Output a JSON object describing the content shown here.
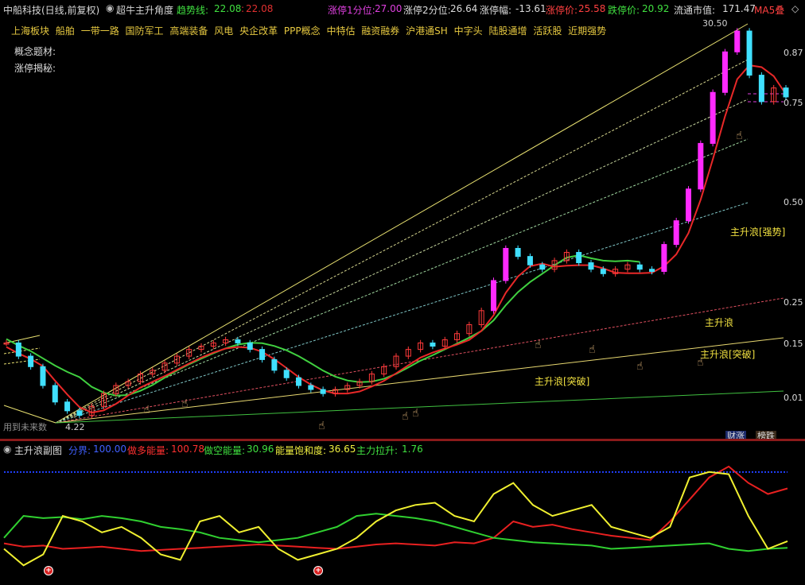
{
  "header": {
    "stock": "中船科技(日线,前复权)",
    "indicator": "超牛主升角度",
    "trend_label": "趋势线:",
    "trend_val1": "22.08",
    "trend_val2": "22.08",
    "lim1_label": "涨停1分位:",
    "lim1_val": "27.00",
    "lim2_label": "涨停2分位:",
    "lim2_val": "26.64",
    "amp_label": "涨停幅:",
    "amp_val": "-13.61",
    "up_label": "涨停价:",
    "up_val": "25.58",
    "down_label": "跌停价:",
    "down_val": "20.92",
    "mcap_label": "流通市值:",
    "mcap_val": "171.47",
    "ma_label": "MA5叠"
  },
  "tags": [
    "上海板块",
    "船舶",
    "一带一路",
    "国防军工",
    "高端装备",
    "风电",
    "央企改革",
    "PPP概念",
    "中特估",
    "融资融券",
    "沪港通SH",
    "中字头",
    "陆股通增",
    "活跃股",
    "近期强势"
  ],
  "concept_label": "概念题材:",
  "reveal_label": "涨停揭秘:",
  "future_label": "用到未来数",
  "low_price": "4.22",
  "peak_price": "30.50",
  "annotations": {
    "wave_break1": "主升浪[突破]",
    "wave": "主升浪",
    "wave_break2": "主升浪[突破]",
    "wave_strong": "主升浪[强势]"
  },
  "buttons": {
    "cai": "财涨",
    "bang": "榜跌"
  },
  "sub": {
    "title": "主升浪副图",
    "div_label": "分界:",
    "div_val": "100.00",
    "bull_label": "做多能量:",
    "bull_val": "100.78",
    "bear_label": "做空能量:",
    "bear_val": "30.96",
    "sat_label": "能量饱和度:",
    "sat_val": "36.65",
    "pull_label": "主力拉升:",
    "pull_val": "1.76"
  },
  "chart_data": [
    {
      "type": "line",
      "title": "超牛主升角度",
      "scale": "log",
      "y_ticks": [
        "0.87",
        "0.75",
        "0.50",
        "0.25",
        "0.15",
        "0.01"
      ],
      "price_high": 30.5,
      "price_low": 4.22,
      "colors": {
        "up": "#ff3a3a",
        "down": "#40e0ff",
        "trend": "#e83030",
        "ma": "#40d040",
        "zhangting": "#ff2aff"
      },
      "series": [
        {
          "values": [
            6.2,
            5.8,
            5.5,
            5.0,
            4.6,
            4.4,
            4.3,
            4.5,
            4.8,
            5.0,
            5.1,
            5.3,
            5.4,
            5.6,
            5.8,
            6.0,
            6.1,
            6.2,
            6.3,
            6.2,
            6.0,
            5.7,
            5.4,
            5.2,
            5.0,
            4.9,
            4.8,
            4.9,
            5.0,
            5.1,
            5.3,
            5.5,
            5.8,
            6.0,
            6.2,
            6.1,
            6.3,
            6.5,
            6.8,
            7.3,
            8.5,
            10.0,
            9.6,
            9.2,
            9.0,
            9.4,
            9.8,
            9.3,
            9.0,
            8.8,
            9.0,
            9.2,
            9.0,
            8.9,
            10.2,
            11.5,
            13.5,
            17,
            22,
            27,
            30,
            24,
            21,
            22.5,
            21.5
          ]
        }
      ]
    },
    {
      "type": "line",
      "title": "主升浪副图",
      "ylim": [
        0,
        110
      ],
      "series": [
        {
          "name": "分界",
          "values": [
            100,
            100
          ]
        },
        {
          "name": "做多能量",
          "values": [
            35,
            32,
            33,
            30,
            31,
            32,
            30,
            28,
            29,
            30,
            31,
            32,
            33,
            34,
            33,
            32,
            31,
            30,
            32,
            34,
            35,
            34,
            33,
            36,
            35,
            40,
            55,
            50,
            52,
            48,
            45,
            42,
            40,
            38,
            55,
            75,
            95,
            105,
            90,
            80,
            85
          ]
        },
        {
          "name": "做空能量",
          "values": [
            40,
            60,
            58,
            59,
            57,
            60,
            58,
            55,
            50,
            48,
            45,
            40,
            38,
            36,
            38,
            40,
            45,
            50,
            60,
            62,
            60,
            58,
            55,
            50,
            45,
            40,
            38,
            36,
            35,
            34,
            33,
            30,
            31,
            32,
            33,
            34,
            35,
            30,
            28,
            30,
            31
          ]
        },
        {
          "name": "能量饱和度",
          "values": [
            30,
            15,
            25,
            60,
            55,
            45,
            50,
            40,
            25,
            20,
            55,
            60,
            45,
            50,
            30,
            20,
            25,
            30,
            40,
            55,
            65,
            70,
            72,
            60,
            55,
            80,
            90,
            70,
            60,
            65,
            70,
            50,
            45,
            40,
            50,
            95,
            100,
            98,
            60,
            30,
            37
          ]
        }
      ]
    }
  ]
}
